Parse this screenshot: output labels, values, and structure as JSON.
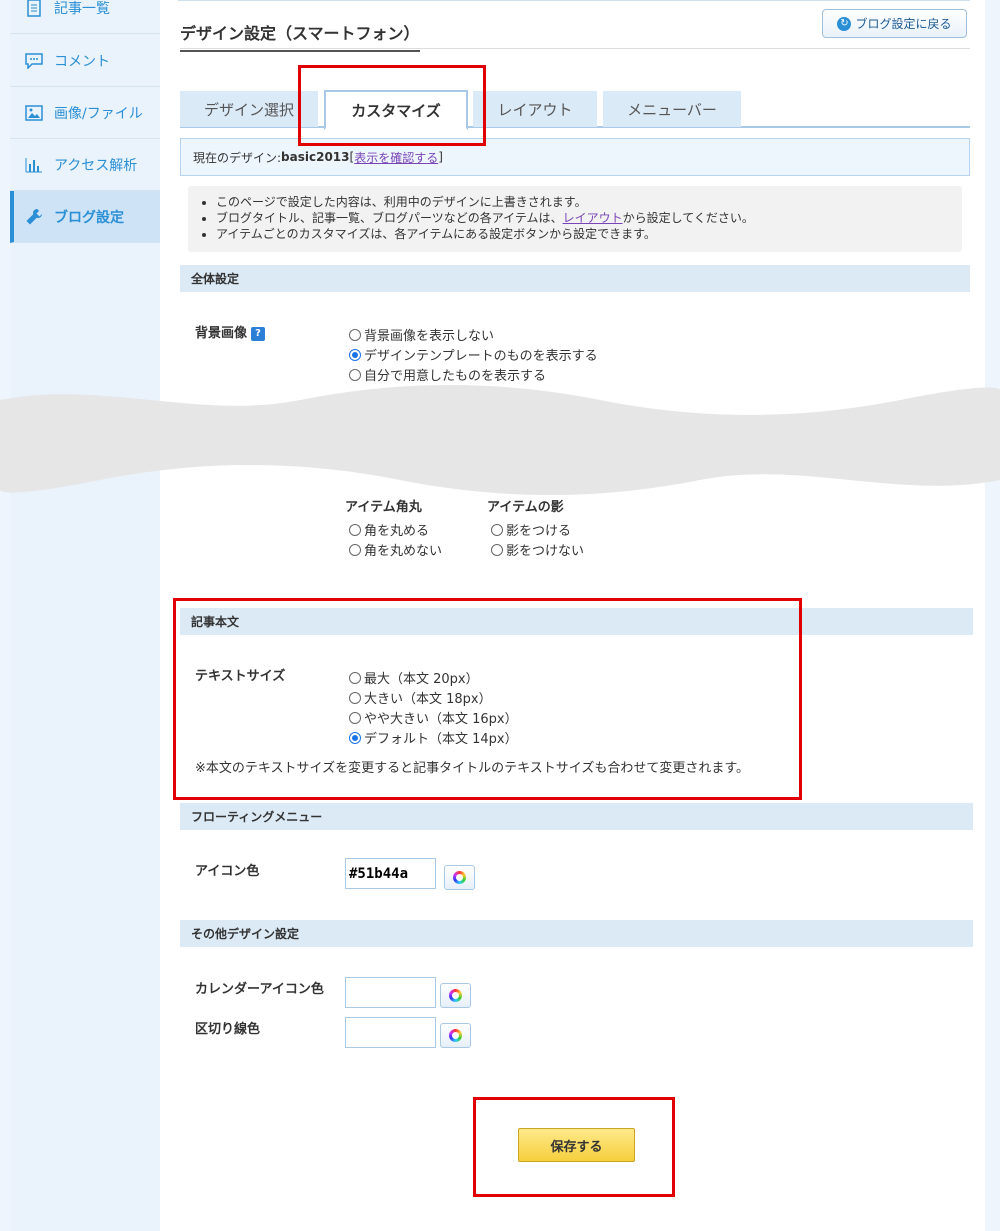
{
  "sidebar": {
    "items": [
      {
        "label": "記事一覧",
        "icon": "document-list-icon"
      },
      {
        "label": "コメント",
        "icon": "comment-icon"
      },
      {
        "label": "画像/ファイル",
        "icon": "image-icon"
      },
      {
        "label": "アクセス解析",
        "icon": "bar-chart-icon"
      },
      {
        "label": "ブログ設定",
        "icon": "wrench-icon",
        "active": true
      }
    ]
  },
  "header": {
    "title": "デザイン設定（スマートフォン）",
    "back_label": "ブログ設定に戻る"
  },
  "tabs": [
    {
      "label": "デザイン選択"
    },
    {
      "label": "カスタマイズ",
      "active": true
    },
    {
      "label": "レイアウト"
    },
    {
      "label": "メニューバー"
    }
  ],
  "current_design": {
    "prefix": "現在のデザイン: ",
    "name": "basic2013",
    "open_bracket": "[",
    "link": "表示を確認する",
    "close_bracket": "]"
  },
  "notes": {
    "line1": "このページで設定した内容は、利用中のデザインに上書きされます。",
    "line2_pre": "ブログタイトル、記事一覧、ブログパーツなどの各アイテムは、",
    "line2_link": "レイアウト",
    "line2_post": "から設定してください。",
    "line3": "アイテムごとのカスタマイズは、各アイテムにある設定ボタンから設定できます。"
  },
  "global_settings": {
    "header": "全体設定",
    "bg_label": "背景画像",
    "help": "?",
    "bg_options": [
      {
        "label": "背景画像を表示しない",
        "checked": false
      },
      {
        "label": "デザインテンプレートのものを表示する",
        "checked": true
      },
      {
        "label": "自分で用意したものを表示する",
        "checked": false
      }
    ],
    "corner_label": "アイテム角丸",
    "corner_options": [
      {
        "label": "角を丸める",
        "checked": false
      },
      {
        "label": "角を丸めない",
        "checked": false
      }
    ],
    "shadow_label": "アイテムの影",
    "shadow_options": [
      {
        "label": "影をつける",
        "checked": false
      },
      {
        "label": "影をつけない",
        "checked": false
      }
    ]
  },
  "article_body": {
    "header": "記事本文",
    "text_size_label": "テキストサイズ",
    "options": [
      {
        "label": "最大（本文 20px）",
        "checked": false
      },
      {
        "label": "大きい（本文 18px）",
        "checked": false
      },
      {
        "label": "やや大きい（本文 16px）",
        "checked": false
      },
      {
        "label": "デフォルト（本文 14px）",
        "checked": true
      }
    ],
    "note": "※本文のテキストサイズを変更すると記事タイトルのテキストサイズも合わせて変更されます。"
  },
  "floating_menu": {
    "header": "フローティングメニュー",
    "icon_color_label": "アイコン色",
    "icon_color_value": "#51b44a"
  },
  "other_design": {
    "header": "その他デザイン設定",
    "calendar_label": "カレンダーアイコン色",
    "calendar_value": "",
    "divider_label": "区切り線色",
    "divider_value": ""
  },
  "save_label": "保存する",
  "colors": {
    "accent": "#2b8fd6",
    "highlight": "#e00000",
    "save": "#f5cf3d"
  }
}
